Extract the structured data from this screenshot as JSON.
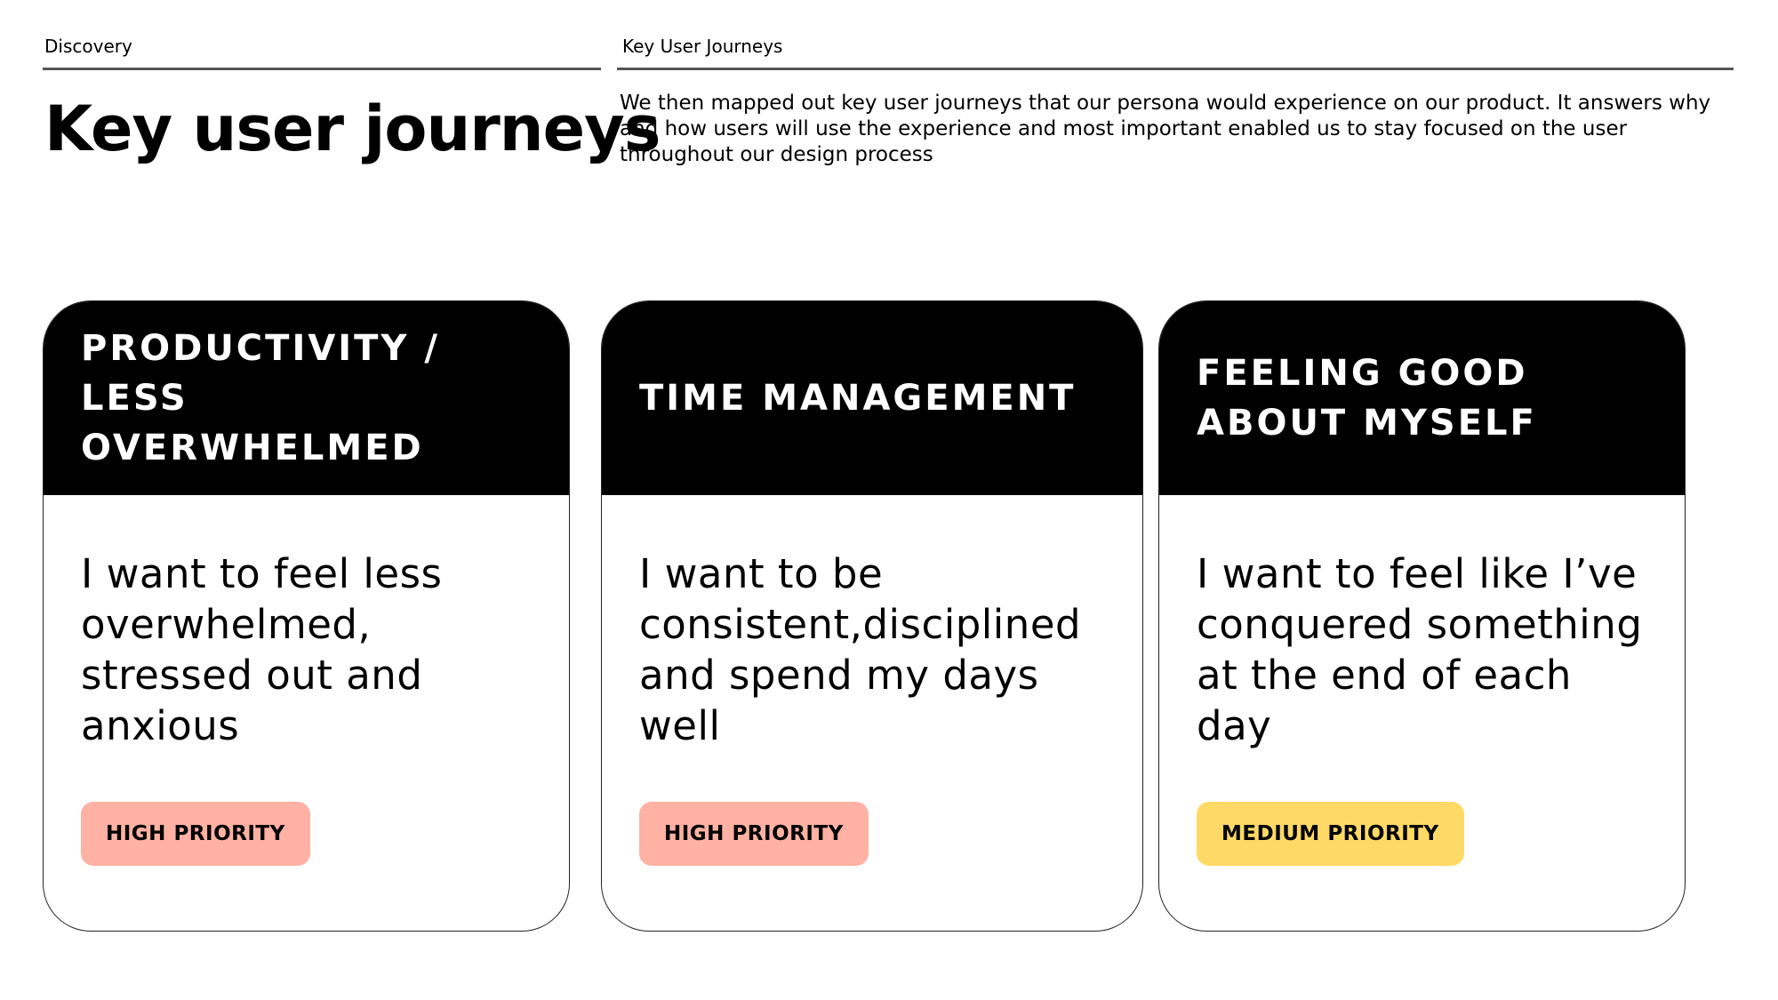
{
  "header": {
    "left_label": "Discovery",
    "right_label": "Key User Journeys"
  },
  "title": "Key user journeys",
  "intro": "We then mapped out key user journeys that our persona would experience on our product. It answers why and how users will use the experience and most important enabled us to stay focused on the user throughout our design process",
  "colors": {
    "header_bg": "#000000",
    "high_priority": "#FFB1A3",
    "medium_priority": "#FFD966"
  },
  "cards": [
    {
      "title": "PRODUCTIVITY / LESS OVERWHELMED",
      "text": "I want to feel less overwhelmed, stressed out and anxious",
      "priority": "HIGH PRIORITY",
      "priority_color": "#FFB1A3"
    },
    {
      "title": "TIME MANAGEMENT",
      "text": "I want to be consistent,disciplined and spend my days well",
      "priority": "HIGH PRIORITY",
      "priority_color": "#FFB1A3"
    },
    {
      "title": "FEELING GOOD ABOUT MYSELF",
      "text": "I want to feel like I’ve conquered something at the end of each day",
      "priority": "MEDIUM PRIORITY",
      "priority_color": "#FFD966"
    }
  ]
}
